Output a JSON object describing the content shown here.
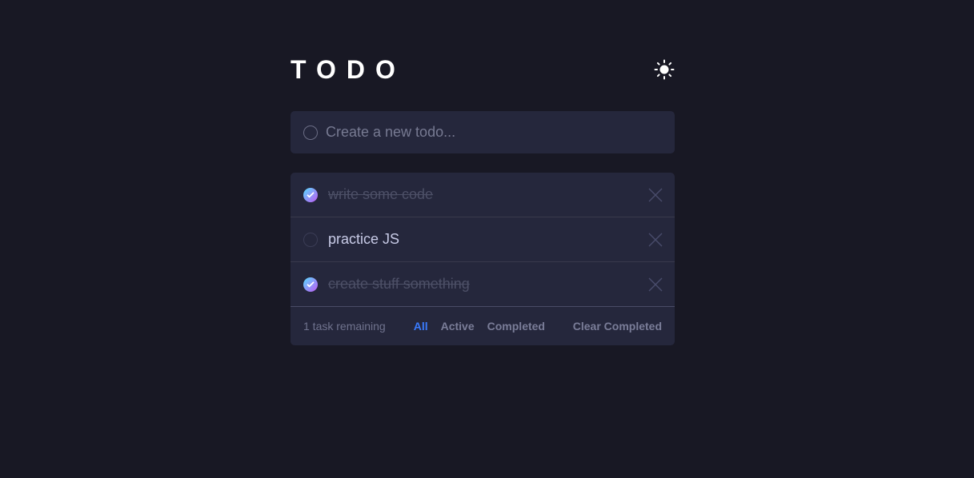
{
  "header": {
    "title": "TODO",
    "theme_icon": "sun-icon"
  },
  "new_todo": {
    "placeholder": "Create a new todo...",
    "value": ""
  },
  "todos": [
    {
      "text": "write some code",
      "completed": true
    },
    {
      "text": "practice JS",
      "completed": false
    },
    {
      "text": "create stuff something",
      "completed": true
    }
  ],
  "footer": {
    "remaining": "1 task remaining",
    "filters": [
      {
        "label": "All",
        "active": true
      },
      {
        "label": "Active",
        "active": false
      },
      {
        "label": "Completed",
        "active": false
      }
    ],
    "clear_label": "Clear Completed"
  },
  "colors": {
    "background": "#181824",
    "panel": "#25273c",
    "accent": "#3a7bfd",
    "check_gradient_start": "#57ddff",
    "check_gradient_end": "#c058f3"
  }
}
